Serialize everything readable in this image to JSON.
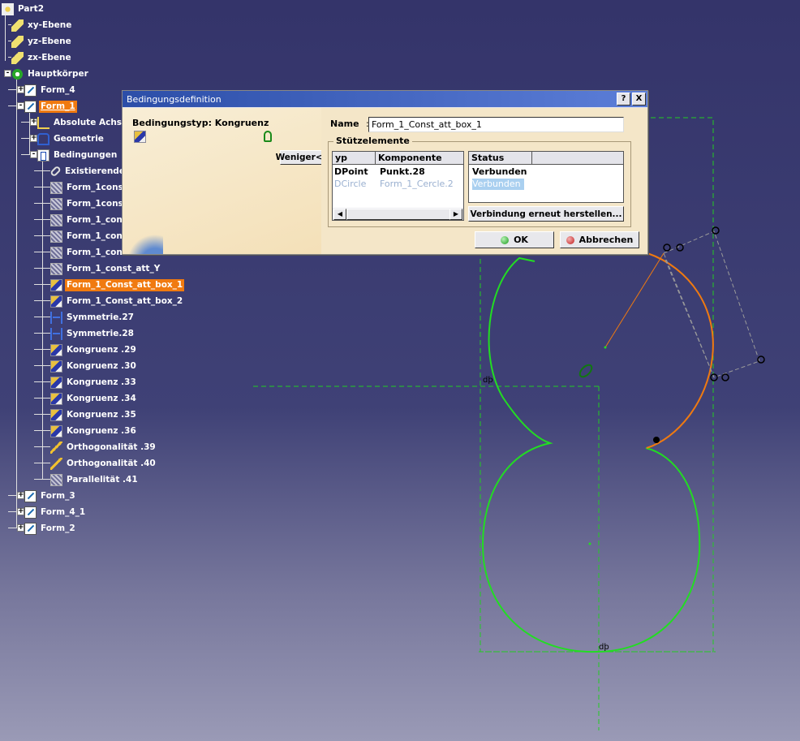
{
  "tree": {
    "items": [
      {
        "label": "Part2",
        "icon": "part-icon"
      },
      {
        "label": "xy-Ebene",
        "icon": "plane-icon"
      },
      {
        "label": "yz-Ebene",
        "icon": "plane-icon"
      },
      {
        "label": "zx-Ebene",
        "icon": "plane-icon"
      },
      {
        "label": "Hauptkörper",
        "icon": "body-icon"
      },
      {
        "label": "Form_4",
        "icon": "sketch-icon"
      },
      {
        "label": "Form_1",
        "icon": "sketch-icon"
      },
      {
        "label": "Absolute Achse",
        "icon": "axis-icon"
      },
      {
        "label": "Geometrie",
        "icon": "geometry-icon"
      },
      {
        "label": "Bedingungen",
        "icon": "constraint-set-icon"
      },
      {
        "label": "Existierende",
        "icon": "link-icon"
      },
      {
        "label": "Form_1cons",
        "icon": "constraint-icon"
      },
      {
        "label": "Form_1cons",
        "icon": "constraint-icon"
      },
      {
        "label": "Form_1_cons",
        "icon": "constraint-icon"
      },
      {
        "label": "Form_1_con",
        "icon": "constraint-icon"
      },
      {
        "label": "Form_1_con",
        "icon": "constraint-icon"
      },
      {
        "label": "Form_1_const_att_Y",
        "icon": "constraint-icon"
      },
      {
        "label": "Form_1_Const_att_box_1",
        "icon": "congruence-icon"
      },
      {
        "label": "Form_1_Const_att_box_2",
        "icon": "congruence-icon"
      },
      {
        "label": "Symmetrie.27",
        "icon": "symmetry-icon"
      },
      {
        "label": "Symmetrie.28",
        "icon": "symmetry-icon"
      },
      {
        "label": "Kongruenz .29",
        "icon": "congruence-icon"
      },
      {
        "label": "Kongruenz .30",
        "icon": "congruence-icon"
      },
      {
        "label": "Kongruenz .33",
        "icon": "congruence-icon"
      },
      {
        "label": "Kongruenz .34",
        "icon": "congruence-icon"
      },
      {
        "label": "Kongruenz .35",
        "icon": "congruence-icon"
      },
      {
        "label": "Kongruenz .36",
        "icon": "congruence-icon"
      },
      {
        "label": "Orthogonalität .39",
        "icon": "orthogonality-icon"
      },
      {
        "label": "Orthogonalität .40",
        "icon": "orthogonality-icon"
      },
      {
        "label": "Parallelität .41",
        "icon": "parallelism-icon"
      },
      {
        "label": "Form_3",
        "icon": "sketch-icon"
      },
      {
        "label": "Form_4_1",
        "icon": "sketch-icon"
      },
      {
        "label": "Form_2",
        "icon": "sketch-icon"
      }
    ]
  },
  "dialog": {
    "title": "Bedingungsdefinition",
    "help_label": "?",
    "close_label": "X",
    "constraint_type_label": "Bedingungstyp: Kongruenz",
    "less_button": "Weniger<<",
    "name_label": "Name",
    "name_value": "Form_1_Const_att_box_1",
    "group_label": "Stützelemente",
    "columns": {
      "type": "yp",
      "component": "Komponente",
      "status": "Status"
    },
    "rows": [
      {
        "type": "DPoint",
        "component": "Punkt.28",
        "status": "Verbunden"
      },
      {
        "type": "DCircle",
        "component": "Form_1_Cercle.2",
        "status": "Verbunden"
      }
    ],
    "reconnect_button": "Verbindung erneut herstellen...",
    "ok_button": "OK",
    "cancel_button": "Abbrechen"
  },
  "colors": {
    "background_top": "#34346a",
    "sketch_green": "#22dd22",
    "selected_orange": "#f07a10",
    "dialog_title": "#2c4ea8"
  }
}
